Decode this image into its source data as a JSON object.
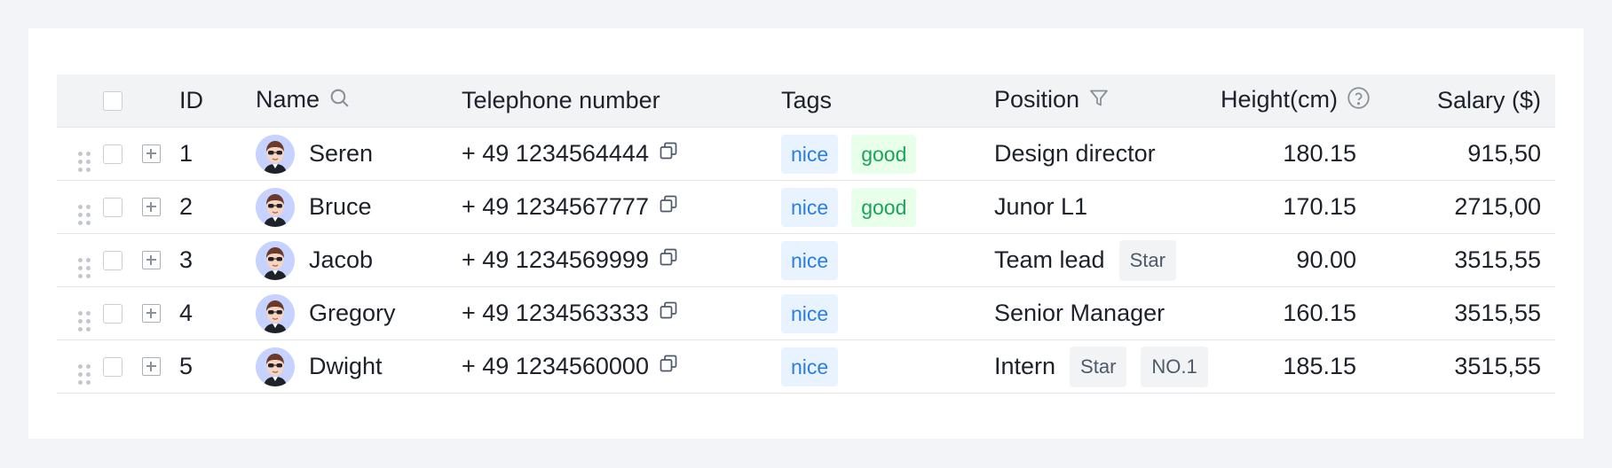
{
  "table": {
    "columns": {
      "id": "ID",
      "name": "Name",
      "phone": "Telephone number",
      "tags": "Tags",
      "position": "Position",
      "height": "Height(cm)",
      "salary": "Salary ($)"
    },
    "header_icons": {
      "name": "search-icon",
      "position": "filter-icon",
      "height": "help-circle-icon"
    },
    "tag_colors": {
      "nice": "#2b7ee0",
      "good": "#1aa35b"
    },
    "rows": [
      {
        "id": "1",
        "name": "Seren",
        "phone": "+ 49 1234564444",
        "tags": [
          "nice",
          "good"
        ],
        "position": "Design director",
        "position_badges": [],
        "height": "180.15",
        "salary": "915,50"
      },
      {
        "id": "2",
        "name": "Bruce",
        "phone": "+ 49 1234567777",
        "tags": [
          "nice",
          "good"
        ],
        "position": "Junor L1",
        "position_badges": [],
        "height": "170.15",
        "salary": "2715,00"
      },
      {
        "id": "3",
        "name": "Jacob",
        "phone": "+ 49 1234569999",
        "tags": [
          "nice"
        ],
        "position": "Team lead",
        "position_badges": [
          "Star"
        ],
        "height": "90.00",
        "salary": "3515,55"
      },
      {
        "id": "4",
        "name": "Gregory",
        "phone": "+ 49 1234563333",
        "tags": [
          "nice"
        ],
        "position": "Senior Manager",
        "position_badges": [],
        "height": "160.15",
        "salary": "3515,55"
      },
      {
        "id": "5",
        "name": "Dwight",
        "phone": "+ 49 1234560000",
        "tags": [
          "nice"
        ],
        "position": "Intern",
        "position_badges": [
          "Star",
          "NO.1"
        ],
        "height": "185.15",
        "salary": "3515,55"
      }
    ]
  }
}
